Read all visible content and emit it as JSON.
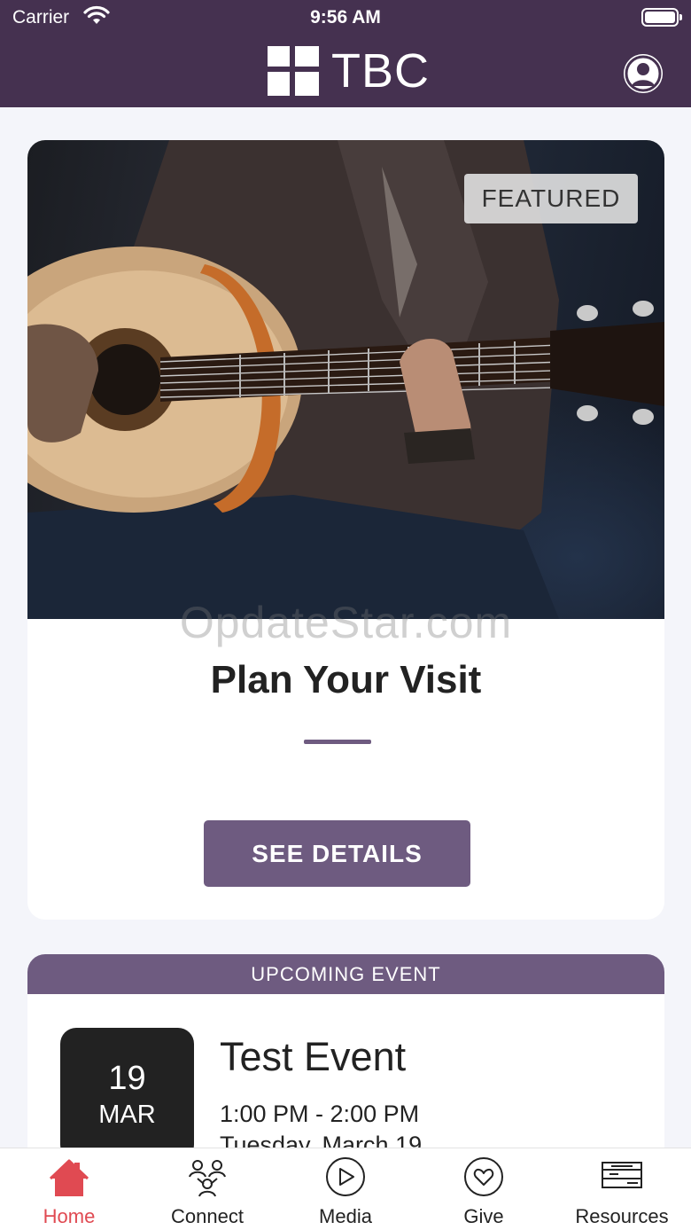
{
  "status_bar": {
    "carrier": "Carrier",
    "time": "9:56 AM"
  },
  "header": {
    "logo_text": "TBC",
    "profile_icon": "profile-icon"
  },
  "featured": {
    "badge": "FEATURED",
    "watermark": "OpdateStar.com",
    "title": "Plan Your Visit",
    "button_label": "SEE DETAILS"
  },
  "event": {
    "header": "UPCOMING EVENT",
    "day": "19",
    "month": "MAR",
    "title": "Test Event",
    "time": "1:00 PM - 2:00 PM",
    "date": "Tuesday, March 19"
  },
  "tabs": [
    {
      "label": "Home",
      "icon": "home-icon",
      "active": true
    },
    {
      "label": "Connect",
      "icon": "connect-icon",
      "active": false
    },
    {
      "label": "Media",
      "icon": "play-icon",
      "active": false
    },
    {
      "label": "Give",
      "icon": "heart-icon",
      "active": false
    },
    {
      "label": "Resources",
      "icon": "resources-icon",
      "active": false
    }
  ],
  "colors": {
    "header_bg": "#453150",
    "accent": "#6e5b80",
    "active_tab": "#e04a52"
  }
}
